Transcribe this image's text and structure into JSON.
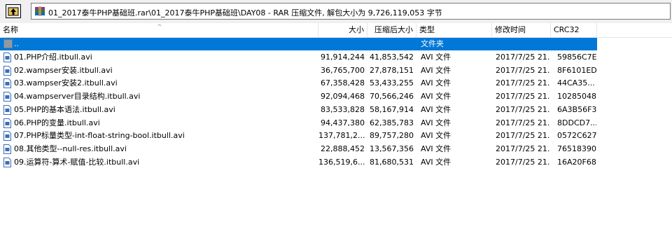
{
  "toolbar": {
    "up_icon": "up-folder-icon",
    "address": "01_2017泰牛PHP基础班.rar\\01_2017泰牛PHP基础班\\DAY08 - RAR 压缩文件, 解包大小为 9,726,119,053 字节"
  },
  "columns": {
    "name": "名称",
    "size": "大小",
    "packed": "压缩后大小",
    "type": "类型",
    "modified": "修改时间",
    "crc": "CRC32"
  },
  "parent_row": {
    "name": "..",
    "type": "文件夹"
  },
  "files": [
    {
      "name": "01.PHP介绍.itbull.avi",
      "size": "91,914,244",
      "packed": "41,853,542",
      "type": "AVI 文件",
      "modified": "2017/7/25 21...",
      "crc": "59856C7E"
    },
    {
      "name": "02.wampser安装.itbull.avi",
      "size": "36,765,700",
      "packed": "27,878,151",
      "type": "AVI 文件",
      "modified": "2017/7/25 21...",
      "crc": "8F6101ED"
    },
    {
      "name": "03.wampser安装2.itbull.avi",
      "size": "67,358,428",
      "packed": "53,433,255",
      "type": "AVI 文件",
      "modified": "2017/7/25 21...",
      "crc": "44CA35..."
    },
    {
      "name": "04.wampserver目录结构.itbull.avi",
      "size": "92,094,468",
      "packed": "70,566,246",
      "type": "AVI 文件",
      "modified": "2017/7/25 21...",
      "crc": "10285048"
    },
    {
      "name": "05.PHP的基本语法.itbull.avi",
      "size": "83,533,828",
      "packed": "58,167,914",
      "type": "AVI 文件",
      "modified": "2017/7/25 21...",
      "crc": "6A3B56F3"
    },
    {
      "name": "06.PHP的变量.itbull.avi",
      "size": "94,437,380",
      "packed": "62,385,783",
      "type": "AVI 文件",
      "modified": "2017/7/25 21...",
      "crc": "8DDCD7..."
    },
    {
      "name": "07.PHP标量类型-int-float-string-bool.itbull.avi",
      "size": "137,781,2...",
      "packed": "89,757,280",
      "type": "AVI 文件",
      "modified": "2017/7/25 21...",
      "crc": "0572C627"
    },
    {
      "name": "08.其他类型--null-res.itbull.avi",
      "size": "22,888,452",
      "packed": "13,567,356",
      "type": "AVI 文件",
      "modified": "2017/7/25 21...",
      "crc": "76518390"
    },
    {
      "name": "09.运算符-算术-赋值-比较.itbull.avi",
      "size": "136,519,6...",
      "packed": "81,680,531",
      "type": "AVI 文件",
      "modified": "2017/7/25 21...",
      "crc": "16A20F68"
    }
  ]
}
